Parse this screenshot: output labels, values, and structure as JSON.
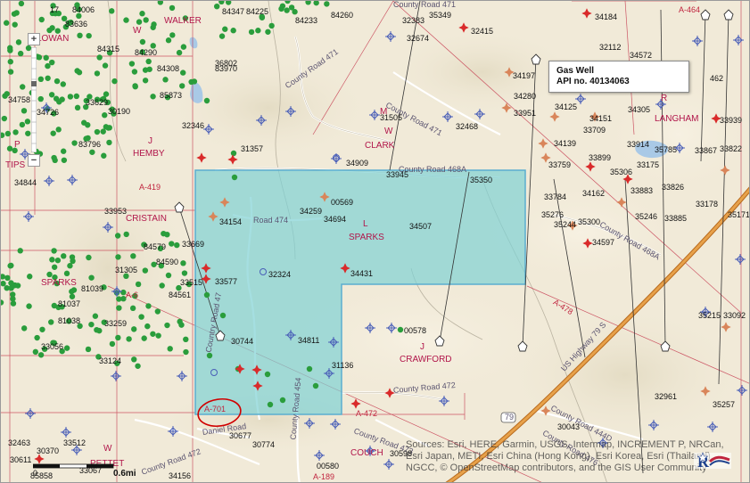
{
  "tooltip": {
    "type": "Gas Well",
    "api": "API no. 40134063"
  },
  "scale": {
    "zero": "0",
    "label": "0.6mi"
  },
  "attribution": "Sources: Esri, HERE, Garmin, USGS, Intermap, INCREMENT P, NRCan, Esri Japan, METI, Esri China (Hong Kong), Esri Korea, Esri (Thailand), NGCC, © OpenStreetMap contributors, and the GIS User Community",
  "place_labels": [
    {
      "text": "WALKER"
    },
    {
      "text": "HEMBY"
    },
    {
      "text": "CLARK"
    },
    {
      "text": "SPARKS"
    },
    {
      "text": "SPARKS"
    },
    {
      "text": "CRAWFORD"
    },
    {
      "text": "LANGHAM"
    },
    {
      "text": "COUCH"
    },
    {
      "text": "CRISTAIN"
    },
    {
      "text": "TIPS"
    },
    {
      "text": "PETTET"
    },
    {
      "text": "LOWAN"
    }
  ],
  "section_labels": [
    {
      "text": "W"
    },
    {
      "text": "L"
    },
    {
      "text": "J"
    },
    {
      "text": "J"
    },
    {
      "text": "R"
    },
    {
      "text": "W"
    },
    {
      "text": "W"
    },
    {
      "text": "P"
    },
    {
      "text": "M"
    }
  ],
  "survey_labels": [
    {
      "text": "A-701"
    },
    {
      "text": "A-472"
    },
    {
      "text": "A-478"
    },
    {
      "text": "A-419"
    },
    {
      "text": "A-6"
    },
    {
      "text": "A-464"
    },
    {
      "text": "A-189"
    }
  ],
  "road_labels": [
    {
      "text": "County Road 471"
    },
    {
      "text": "County Road 471"
    },
    {
      "text": "County Road 468A"
    },
    {
      "text": "Road 474"
    },
    {
      "text": "County Road 468A"
    },
    {
      "text": "County Road 472"
    },
    {
      "text": "County Road 444D"
    },
    {
      "text": "County Road 454"
    },
    {
      "text": "County Road 476"
    },
    {
      "text": "County Road 472"
    },
    {
      "text": "County Road 471"
    },
    {
      "text": "Country Road 47"
    },
    {
      "text": "Daniel Road"
    },
    {
      "text": "County Road 473"
    }
  ],
  "highway_labels": [
    {
      "text": "US Highway 79 S"
    },
    {
      "text": "79"
    }
  ],
  "well_labels": [
    {
      "text": "17"
    },
    {
      "text": "84006"
    },
    {
      "text": "83636"
    },
    {
      "text": "84315"
    },
    {
      "text": "84290"
    },
    {
      "text": "84308"
    },
    {
      "text": "83970"
    },
    {
      "text": "84347"
    },
    {
      "text": "84225"
    },
    {
      "text": "84233"
    },
    {
      "text": "84260"
    },
    {
      "text": "32415"
    },
    {
      "text": "32383"
    },
    {
      "text": "35349"
    },
    {
      "text": "32674"
    },
    {
      "text": "34184"
    },
    {
      "text": "32112"
    },
    {
      "text": "34572"
    },
    {
      "text": "34197"
    },
    {
      "text": "34280"
    },
    {
      "text": "33951"
    },
    {
      "text": "34125"
    },
    {
      "text": "34151"
    },
    {
      "text": "34305"
    },
    {
      "text": "33939"
    },
    {
      "text": "462"
    },
    {
      "text": "33709"
    },
    {
      "text": "33914"
    },
    {
      "text": "35785"
    },
    {
      "text": "33867"
    },
    {
      "text": "33822"
    },
    {
      "text": "34139"
    },
    {
      "text": "33899"
    },
    {
      "text": "33175"
    },
    {
      "text": "33759"
    },
    {
      "text": "35306"
    },
    {
      "text": "33883"
    },
    {
      "text": "33826"
    },
    {
      "text": "33178"
    },
    {
      "text": "34162"
    },
    {
      "text": "33784"
    },
    {
      "text": "35246"
    },
    {
      "text": "33885"
    },
    {
      "text": "35276"
    },
    {
      "text": "35300"
    },
    {
      "text": "35244"
    },
    {
      "text": "35171"
    },
    {
      "text": "34597"
    },
    {
      "text": "31357"
    },
    {
      "text": "31505"
    },
    {
      "text": "32468"
    },
    {
      "text": "32346"
    },
    {
      "text": "34909"
    },
    {
      "text": "33945"
    },
    {
      "text": "35350"
    },
    {
      "text": "00569"
    },
    {
      "text": "34259"
    },
    {
      "text": "34694"
    },
    {
      "text": "34154"
    },
    {
      "text": "34507"
    },
    {
      "text": "33669"
    },
    {
      "text": "84579"
    },
    {
      "text": "84590"
    },
    {
      "text": "33953"
    },
    {
      "text": "34431"
    },
    {
      "text": "32324"
    },
    {
      "text": "33577"
    },
    {
      "text": "31305"
    },
    {
      "text": "33515"
    },
    {
      "text": "84561"
    },
    {
      "text": "81039"
    },
    {
      "text": "81037"
    },
    {
      "text": "81038"
    },
    {
      "text": "33259"
    },
    {
      "text": "30744"
    },
    {
      "text": "34811"
    },
    {
      "text": "00578"
    },
    {
      "text": "31136"
    },
    {
      "text": "33124"
    },
    {
      "text": "33056"
    },
    {
      "text": "32961"
    },
    {
      "text": "35257"
    },
    {
      "text": "30043"
    },
    {
      "text": "32463"
    },
    {
      "text": "33512"
    },
    {
      "text": "30370"
    },
    {
      "text": "30611"
    },
    {
      "text": "30677"
    },
    {
      "text": "30774"
    },
    {
      "text": "00580"
    },
    {
      "text": "30598"
    },
    {
      "text": "34156"
    },
    {
      "text": "33067"
    },
    {
      "text": "85858"
    },
    {
      "text": "83796"
    },
    {
      "text": "33629"
    },
    {
      "text": "34726"
    },
    {
      "text": "34758"
    },
    {
      "text": "30190"
    },
    {
      "text": "36802"
    },
    {
      "text": "35215"
    },
    {
      "text": "33092"
    },
    {
      "text": "34844"
    },
    {
      "text": "85873"
    }
  ],
  "colors": {
    "terrain": "#f1ead8",
    "lease_fill": "#7fd1d4",
    "lease_border": "#5aaed0",
    "survey_line": "#c0243e",
    "well_green": "#2a9d3c",
    "well_red": "#d92a2a",
    "well_blue": "#4a5fb8",
    "highway": "#d9882f",
    "annotation": "#d00000"
  }
}
